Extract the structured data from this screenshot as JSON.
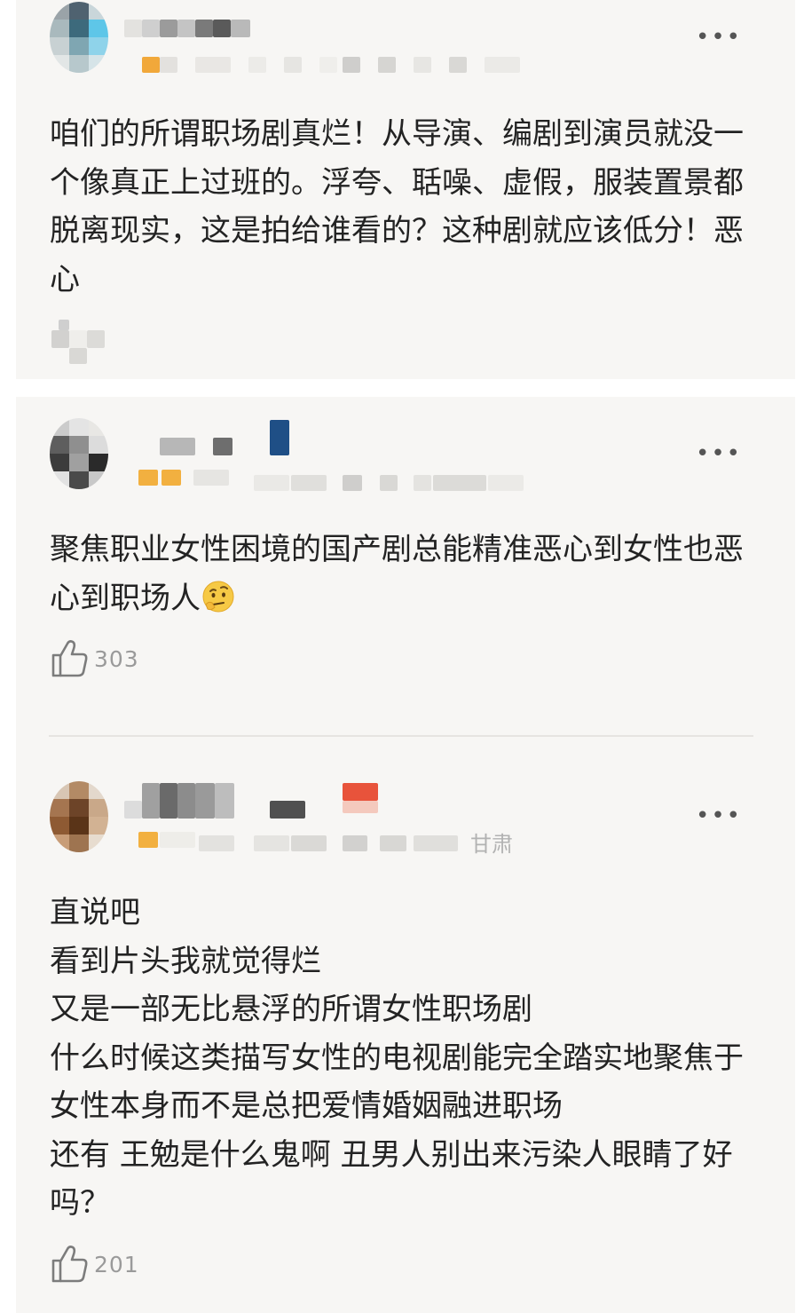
{
  "comments": [
    {
      "text": "咱们的所谓职场剧真烂！从导演、编剧到演员就没一个像真正上过班的。浮夸、聒噪、虚假，服装置景都脱离现实，这是拍给谁看的？这种剧就应该低分！恶心"
    },
    {
      "text": "聚焦职业女性困境的国产剧总能精准恶心到女性也恶心到职场人",
      "emoji": "thinking-face-emoji",
      "likes": "303"
    },
    {
      "location": "甘肃",
      "text": "直说吧\n看到片头我就觉得烂\n又是一部无比悬浮的所谓女性职场剧\n什么时候这类描写女性的电视剧能完全踏实地聚焦于女性本身而不是总把爱情婚姻融进职场\n还有 王勉是什么鬼啊 丑男人别出来污染人眼睛了好吗？",
      "likes": "201"
    }
  ],
  "more_label": "•••",
  "colors": {
    "card": "#f7f6f4",
    "text": "#232323",
    "meta": "#9a9a9a",
    "rating": "#f0a030"
  },
  "icons": {
    "like": "thumbs-up-icon",
    "more": "more-dots-icon"
  }
}
